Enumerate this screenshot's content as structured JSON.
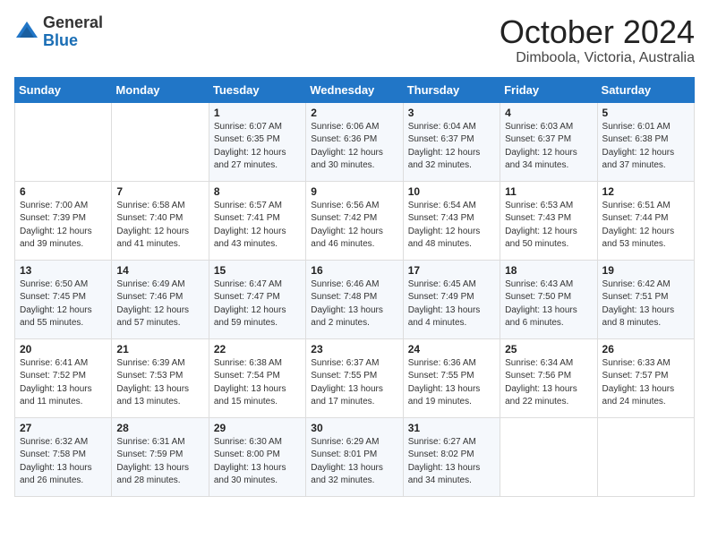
{
  "logo": {
    "general": "General",
    "blue": "Blue"
  },
  "header": {
    "month": "October 2024",
    "location": "Dimboola, Victoria, Australia"
  },
  "weekdays": [
    "Sunday",
    "Monday",
    "Tuesday",
    "Wednesday",
    "Thursday",
    "Friday",
    "Saturday"
  ],
  "weeks": [
    [
      {
        "day": "",
        "info": ""
      },
      {
        "day": "",
        "info": ""
      },
      {
        "day": "1",
        "info": "Sunrise: 6:07 AM\nSunset: 6:35 PM\nDaylight: 12 hours\nand 27 minutes."
      },
      {
        "day": "2",
        "info": "Sunrise: 6:06 AM\nSunset: 6:36 PM\nDaylight: 12 hours\nand 30 minutes."
      },
      {
        "day": "3",
        "info": "Sunrise: 6:04 AM\nSunset: 6:37 PM\nDaylight: 12 hours\nand 32 minutes."
      },
      {
        "day": "4",
        "info": "Sunrise: 6:03 AM\nSunset: 6:37 PM\nDaylight: 12 hours\nand 34 minutes."
      },
      {
        "day": "5",
        "info": "Sunrise: 6:01 AM\nSunset: 6:38 PM\nDaylight: 12 hours\nand 37 minutes."
      }
    ],
    [
      {
        "day": "6",
        "info": "Sunrise: 7:00 AM\nSunset: 7:39 PM\nDaylight: 12 hours\nand 39 minutes."
      },
      {
        "day": "7",
        "info": "Sunrise: 6:58 AM\nSunset: 7:40 PM\nDaylight: 12 hours\nand 41 minutes."
      },
      {
        "day": "8",
        "info": "Sunrise: 6:57 AM\nSunset: 7:41 PM\nDaylight: 12 hours\nand 43 minutes."
      },
      {
        "day": "9",
        "info": "Sunrise: 6:56 AM\nSunset: 7:42 PM\nDaylight: 12 hours\nand 46 minutes."
      },
      {
        "day": "10",
        "info": "Sunrise: 6:54 AM\nSunset: 7:43 PM\nDaylight: 12 hours\nand 48 minutes."
      },
      {
        "day": "11",
        "info": "Sunrise: 6:53 AM\nSunset: 7:43 PM\nDaylight: 12 hours\nand 50 minutes."
      },
      {
        "day": "12",
        "info": "Sunrise: 6:51 AM\nSunset: 7:44 PM\nDaylight: 12 hours\nand 53 minutes."
      }
    ],
    [
      {
        "day": "13",
        "info": "Sunrise: 6:50 AM\nSunset: 7:45 PM\nDaylight: 12 hours\nand 55 minutes."
      },
      {
        "day": "14",
        "info": "Sunrise: 6:49 AM\nSunset: 7:46 PM\nDaylight: 12 hours\nand 57 minutes."
      },
      {
        "day": "15",
        "info": "Sunrise: 6:47 AM\nSunset: 7:47 PM\nDaylight: 12 hours\nand 59 minutes."
      },
      {
        "day": "16",
        "info": "Sunrise: 6:46 AM\nSunset: 7:48 PM\nDaylight: 13 hours\nand 2 minutes."
      },
      {
        "day": "17",
        "info": "Sunrise: 6:45 AM\nSunset: 7:49 PM\nDaylight: 13 hours\nand 4 minutes."
      },
      {
        "day": "18",
        "info": "Sunrise: 6:43 AM\nSunset: 7:50 PM\nDaylight: 13 hours\nand 6 minutes."
      },
      {
        "day": "19",
        "info": "Sunrise: 6:42 AM\nSunset: 7:51 PM\nDaylight: 13 hours\nand 8 minutes."
      }
    ],
    [
      {
        "day": "20",
        "info": "Sunrise: 6:41 AM\nSunset: 7:52 PM\nDaylight: 13 hours\nand 11 minutes."
      },
      {
        "day": "21",
        "info": "Sunrise: 6:39 AM\nSunset: 7:53 PM\nDaylight: 13 hours\nand 13 minutes."
      },
      {
        "day": "22",
        "info": "Sunrise: 6:38 AM\nSunset: 7:54 PM\nDaylight: 13 hours\nand 15 minutes."
      },
      {
        "day": "23",
        "info": "Sunrise: 6:37 AM\nSunset: 7:55 PM\nDaylight: 13 hours\nand 17 minutes."
      },
      {
        "day": "24",
        "info": "Sunrise: 6:36 AM\nSunset: 7:55 PM\nDaylight: 13 hours\nand 19 minutes."
      },
      {
        "day": "25",
        "info": "Sunrise: 6:34 AM\nSunset: 7:56 PM\nDaylight: 13 hours\nand 22 minutes."
      },
      {
        "day": "26",
        "info": "Sunrise: 6:33 AM\nSunset: 7:57 PM\nDaylight: 13 hours\nand 24 minutes."
      }
    ],
    [
      {
        "day": "27",
        "info": "Sunrise: 6:32 AM\nSunset: 7:58 PM\nDaylight: 13 hours\nand 26 minutes."
      },
      {
        "day": "28",
        "info": "Sunrise: 6:31 AM\nSunset: 7:59 PM\nDaylight: 13 hours\nand 28 minutes."
      },
      {
        "day": "29",
        "info": "Sunrise: 6:30 AM\nSunset: 8:00 PM\nDaylight: 13 hours\nand 30 minutes."
      },
      {
        "day": "30",
        "info": "Sunrise: 6:29 AM\nSunset: 8:01 PM\nDaylight: 13 hours\nand 32 minutes."
      },
      {
        "day": "31",
        "info": "Sunrise: 6:27 AM\nSunset: 8:02 PM\nDaylight: 13 hours\nand 34 minutes."
      },
      {
        "day": "",
        "info": ""
      },
      {
        "day": "",
        "info": ""
      }
    ]
  ]
}
